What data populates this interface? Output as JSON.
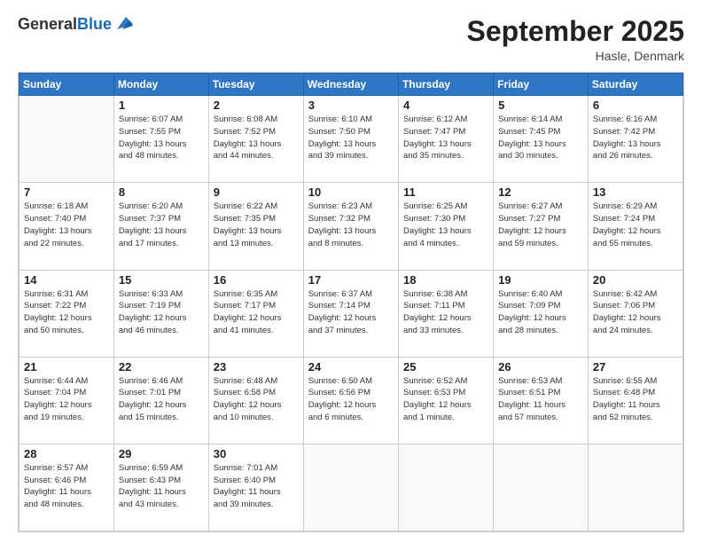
{
  "logo": {
    "general": "General",
    "blue": "Blue"
  },
  "title": "September 2025",
  "subtitle": "Hasle, Denmark",
  "days_header": [
    "Sunday",
    "Monday",
    "Tuesday",
    "Wednesday",
    "Thursday",
    "Friday",
    "Saturday"
  ],
  "weeks": [
    [
      {
        "day": "",
        "info": ""
      },
      {
        "day": "1",
        "info": "Sunrise: 6:07 AM\nSunset: 7:55 PM\nDaylight: 13 hours\nand 48 minutes."
      },
      {
        "day": "2",
        "info": "Sunrise: 6:08 AM\nSunset: 7:52 PM\nDaylight: 13 hours\nand 44 minutes."
      },
      {
        "day": "3",
        "info": "Sunrise: 6:10 AM\nSunset: 7:50 PM\nDaylight: 13 hours\nand 39 minutes."
      },
      {
        "day": "4",
        "info": "Sunrise: 6:12 AM\nSunset: 7:47 PM\nDaylight: 13 hours\nand 35 minutes."
      },
      {
        "day": "5",
        "info": "Sunrise: 6:14 AM\nSunset: 7:45 PM\nDaylight: 13 hours\nand 30 minutes."
      },
      {
        "day": "6",
        "info": "Sunrise: 6:16 AM\nSunset: 7:42 PM\nDaylight: 13 hours\nand 26 minutes."
      }
    ],
    [
      {
        "day": "7",
        "info": "Sunrise: 6:18 AM\nSunset: 7:40 PM\nDaylight: 13 hours\nand 22 minutes."
      },
      {
        "day": "8",
        "info": "Sunrise: 6:20 AM\nSunset: 7:37 PM\nDaylight: 13 hours\nand 17 minutes."
      },
      {
        "day": "9",
        "info": "Sunrise: 6:22 AM\nSunset: 7:35 PM\nDaylight: 13 hours\nand 13 minutes."
      },
      {
        "day": "10",
        "info": "Sunrise: 6:23 AM\nSunset: 7:32 PM\nDaylight: 13 hours\nand 8 minutes."
      },
      {
        "day": "11",
        "info": "Sunrise: 6:25 AM\nSunset: 7:30 PM\nDaylight: 13 hours\nand 4 minutes."
      },
      {
        "day": "12",
        "info": "Sunrise: 6:27 AM\nSunset: 7:27 PM\nDaylight: 12 hours\nand 59 minutes."
      },
      {
        "day": "13",
        "info": "Sunrise: 6:29 AM\nSunset: 7:24 PM\nDaylight: 12 hours\nand 55 minutes."
      }
    ],
    [
      {
        "day": "14",
        "info": "Sunrise: 6:31 AM\nSunset: 7:22 PM\nDaylight: 12 hours\nand 50 minutes."
      },
      {
        "day": "15",
        "info": "Sunrise: 6:33 AM\nSunset: 7:19 PM\nDaylight: 12 hours\nand 46 minutes."
      },
      {
        "day": "16",
        "info": "Sunrise: 6:35 AM\nSunset: 7:17 PM\nDaylight: 12 hours\nand 41 minutes."
      },
      {
        "day": "17",
        "info": "Sunrise: 6:37 AM\nSunset: 7:14 PM\nDaylight: 12 hours\nand 37 minutes."
      },
      {
        "day": "18",
        "info": "Sunrise: 6:38 AM\nSunset: 7:11 PM\nDaylight: 12 hours\nand 33 minutes."
      },
      {
        "day": "19",
        "info": "Sunrise: 6:40 AM\nSunset: 7:09 PM\nDaylight: 12 hours\nand 28 minutes."
      },
      {
        "day": "20",
        "info": "Sunrise: 6:42 AM\nSunset: 7:06 PM\nDaylight: 12 hours\nand 24 minutes."
      }
    ],
    [
      {
        "day": "21",
        "info": "Sunrise: 6:44 AM\nSunset: 7:04 PM\nDaylight: 12 hours\nand 19 minutes."
      },
      {
        "day": "22",
        "info": "Sunrise: 6:46 AM\nSunset: 7:01 PM\nDaylight: 12 hours\nand 15 minutes."
      },
      {
        "day": "23",
        "info": "Sunrise: 6:48 AM\nSunset: 6:58 PM\nDaylight: 12 hours\nand 10 minutes."
      },
      {
        "day": "24",
        "info": "Sunrise: 6:50 AM\nSunset: 6:56 PM\nDaylight: 12 hours\nand 6 minutes."
      },
      {
        "day": "25",
        "info": "Sunrise: 6:52 AM\nSunset: 6:53 PM\nDaylight: 12 hours\nand 1 minute."
      },
      {
        "day": "26",
        "info": "Sunrise: 6:53 AM\nSunset: 6:51 PM\nDaylight: 11 hours\nand 57 minutes."
      },
      {
        "day": "27",
        "info": "Sunrise: 6:55 AM\nSunset: 6:48 PM\nDaylight: 11 hours\nand 52 minutes."
      }
    ],
    [
      {
        "day": "28",
        "info": "Sunrise: 6:57 AM\nSunset: 6:46 PM\nDaylight: 11 hours\nand 48 minutes."
      },
      {
        "day": "29",
        "info": "Sunrise: 6:59 AM\nSunset: 6:43 PM\nDaylight: 11 hours\nand 43 minutes."
      },
      {
        "day": "30",
        "info": "Sunrise: 7:01 AM\nSunset: 6:40 PM\nDaylight: 11 hours\nand 39 minutes."
      },
      {
        "day": "",
        "info": ""
      },
      {
        "day": "",
        "info": ""
      },
      {
        "day": "",
        "info": ""
      },
      {
        "day": "",
        "info": ""
      }
    ]
  ]
}
